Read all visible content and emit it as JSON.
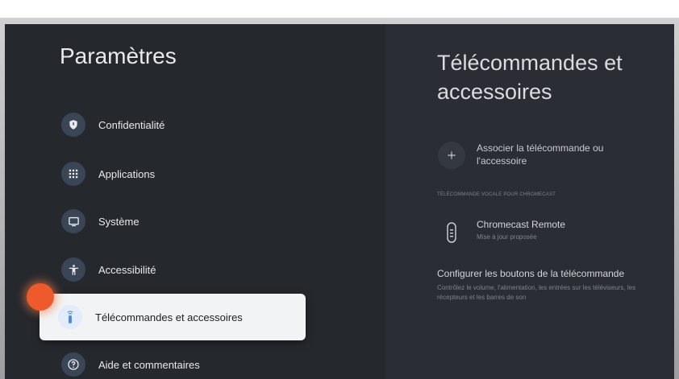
{
  "settings": {
    "title": "Paramètres",
    "items": [
      {
        "label": "Confidentialité",
        "icon": "shield-icon"
      },
      {
        "label": "Applications",
        "icon": "apps-grid-icon"
      },
      {
        "label": "Système",
        "icon": "monitor-icon"
      },
      {
        "label": "Accessibilité",
        "icon": "accessibility-icon"
      },
      {
        "label": "Télécommandes et accessoires",
        "icon": "remote-icon",
        "selected": true
      },
      {
        "label": "Aide et commentaires",
        "icon": "help-icon"
      }
    ]
  },
  "detail": {
    "title": "Télécommandes et accessoires",
    "pair_label": "Associer la télécommande ou l'accessoire",
    "section_header": "TÉLÉCOMMANDE VOCALE POUR CHROMECAST",
    "remote_name": "Chromecast Remote",
    "remote_status": "Mise à jour proposée",
    "config_title": "Configurer les boutons de la télécommande",
    "config_desc": "Contrôlez le volume, l'alimentation, les entrées sur les téléviseurs, les récepteurs et les barres de son"
  },
  "colors": {
    "background": "#212428",
    "selected_bg": "#f1f3f4",
    "accent": "#4a86e8",
    "touch_indicator": "#ee5a2b"
  }
}
